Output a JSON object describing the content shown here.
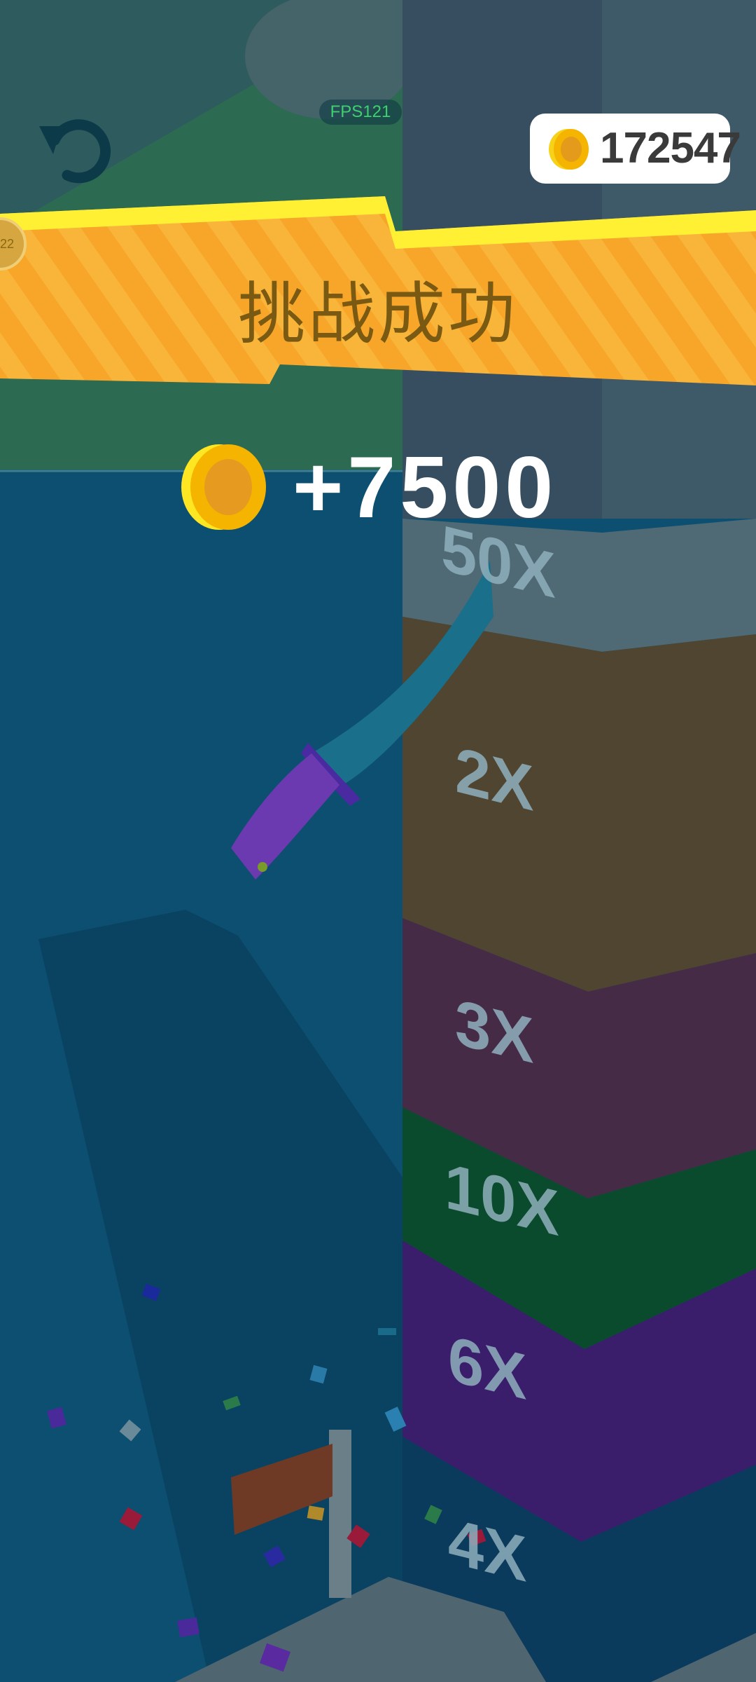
{
  "hud": {
    "fps_label": "FPS121",
    "coin_balance": "172547",
    "restart_icon": "restart-icon",
    "coin_icon": "coin-icon"
  },
  "result": {
    "banner_title": "挑战成功",
    "reward": "+7500",
    "badge_text": "22"
  },
  "tower": {
    "multipliers": [
      "50X",
      "2X",
      "3X",
      "10X",
      "6X",
      "4X"
    ]
  },
  "colors": {
    "banner": "#f7a823",
    "banner_highlight": "#ffe733",
    "coin": "#f5b400",
    "fps_text": "#3fcf6f",
    "water": "#0d4f70"
  }
}
